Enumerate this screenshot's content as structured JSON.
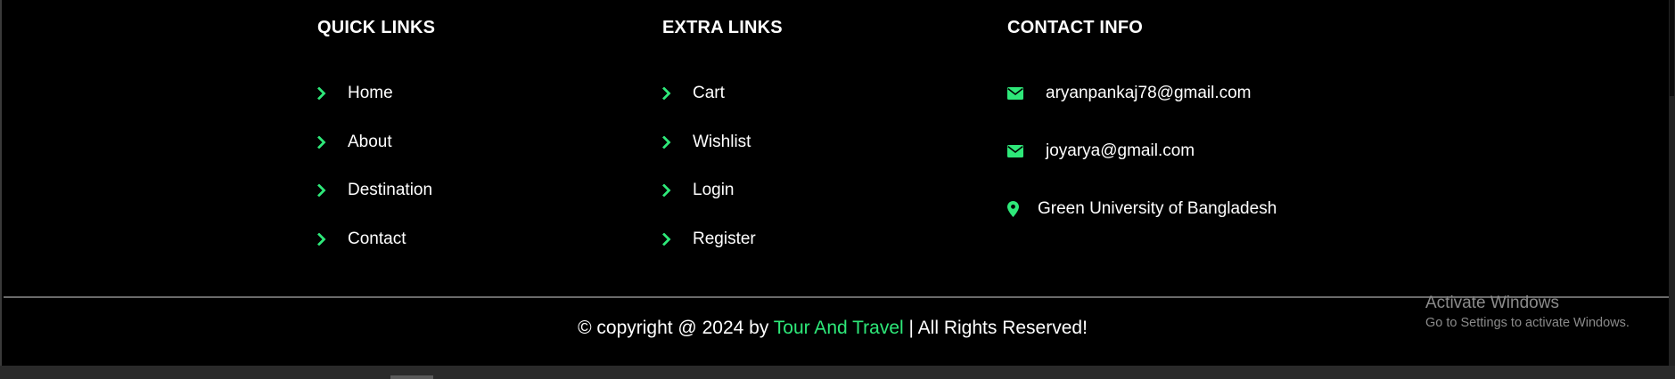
{
  "quick_links": {
    "title": "QUICK LINKS",
    "items": [
      {
        "label": "Home",
        "icon": "chevron-right-icon"
      },
      {
        "label": "About",
        "icon": "chevron-right-icon"
      },
      {
        "label": "Destination",
        "icon": "chevron-right-icon"
      },
      {
        "label": "Contact",
        "icon": "chevron-right-icon"
      }
    ]
  },
  "extra_links": {
    "title": "EXTRA LINKS",
    "items": [
      {
        "label": "Cart",
        "icon": "chevron-right-icon"
      },
      {
        "label": "Wishlist",
        "icon": "chevron-right-icon"
      },
      {
        "label": "Login",
        "icon": "chevron-right-icon"
      },
      {
        "label": "Register",
        "icon": "chevron-right-icon"
      }
    ]
  },
  "contact_info": {
    "title": "CONTACT INFO",
    "items": [
      {
        "text": "aryanpankaj78@gmail.com",
        "icon": "envelope-icon"
      },
      {
        "text": "joyarya@gmail.com",
        "icon": "envelope-icon"
      },
      {
        "text": "Green University of Bangladesh",
        "icon": "map-marker-icon"
      }
    ]
  },
  "copyright": {
    "prefix": "© copyright @ 2024 by ",
    "brand": "Tour And Travel",
    "suffix": " | All Rights Reserved!"
  },
  "windows_watermark": {
    "title": "Activate Windows",
    "subtitle": "Go to Settings to activate Windows."
  },
  "colors": {
    "accent": "#2ee879",
    "background": "#000000",
    "text": "#ffffff",
    "watermark": "#8b8b8b"
  }
}
